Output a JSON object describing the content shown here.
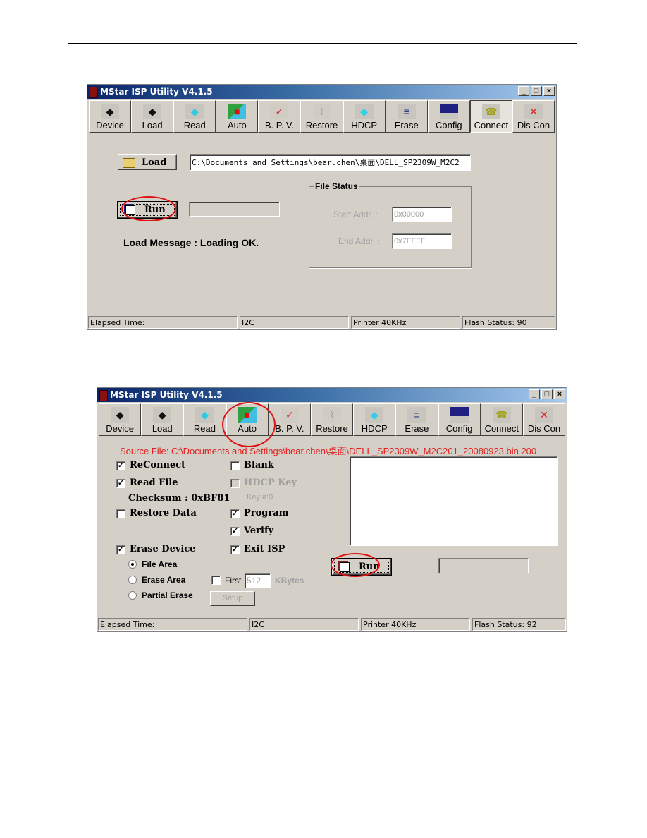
{
  "window_title": "MStar ISP Utility V4.1.5",
  "window_controls": {
    "minimize": "_",
    "maximize": "□",
    "close": "×"
  },
  "toolbar": [
    {
      "label": "Device",
      "icon": "chip-icon"
    },
    {
      "label": "Load",
      "icon": "chip-load-icon"
    },
    {
      "label": "Read",
      "icon": "read-icon"
    },
    {
      "label": "Auto",
      "icon": "auto-icon"
    },
    {
      "label": "B. P. V.",
      "icon": "check-icon"
    },
    {
      "label": "Restore",
      "icon": "restore-icon"
    },
    {
      "label": "HDCP",
      "icon": "hdcp-icon"
    },
    {
      "label": "Erase",
      "icon": "erase-icon"
    },
    {
      "label": "Config",
      "icon": "config-icon"
    },
    {
      "label": "Connect",
      "icon": "telephone-icon"
    },
    {
      "label": "Dis Con",
      "icon": "disconnect-icon"
    }
  ],
  "screen1": {
    "load_button": "Load",
    "file_path": "C:\\Documents and Settings\\bear.chen\\桌面\\DELL_SP2309W_M2C2",
    "run_button": "Run",
    "progress_text": "",
    "load_message": "Load Message : Loading OK.",
    "file_status": {
      "title": "File Status",
      "start_label": "Start Addr. :",
      "start_value": "0x00000",
      "end_label": "End Addr. :",
      "end_value": "0x7FFFF"
    },
    "status": {
      "elapsed": "Elapsed Time:",
      "bus": "I2C",
      "printer": "Printer  40KHz",
      "flash": "Flash Status: 90"
    }
  },
  "screen2": {
    "source_file": "Source File: C:\\Documents and Settings\\bear.chen\\桌面\\DELL_SP2309W_M2C201_20080923.bin 200",
    "options_left": {
      "reconnect": {
        "label": "ReConnect",
        "checked": true
      },
      "read_file": {
        "label": "Read File",
        "checked": true
      },
      "checksum": "Checksum : 0xBF81",
      "restore_data": {
        "label": "Restore Data",
        "checked": false
      },
      "erase_device": {
        "label": "Erase Device",
        "checked": true
      },
      "erase_modes": [
        {
          "label": "File Area",
          "selected": true
        },
        {
          "label": "Erase Area",
          "selected": false
        },
        {
          "label": "Partial Erase",
          "selected": false
        }
      ]
    },
    "options_right": {
      "blank": {
        "label": "Blank",
        "checked": false
      },
      "hdcp_key": {
        "label": "HDCP Key",
        "checked": false,
        "disabled": true
      },
      "key_no": "Key #:0",
      "program": {
        "label": "Program",
        "checked": true
      },
      "verify": {
        "label": "Verify",
        "checked": true
      },
      "exit_isp": {
        "label": "Exit ISP",
        "checked": true
      }
    },
    "first": {
      "label": "First",
      "checked": false,
      "value": "512",
      "unit": "KBytes"
    },
    "setup_button": "Setup",
    "run_button": "Run",
    "log_text": "",
    "status": {
      "elapsed": "Elapsed Time:",
      "bus": "I2C",
      "printer": "Printer  40KHz",
      "flash": "Flash Status: 92"
    }
  },
  "check_mark": "✓"
}
